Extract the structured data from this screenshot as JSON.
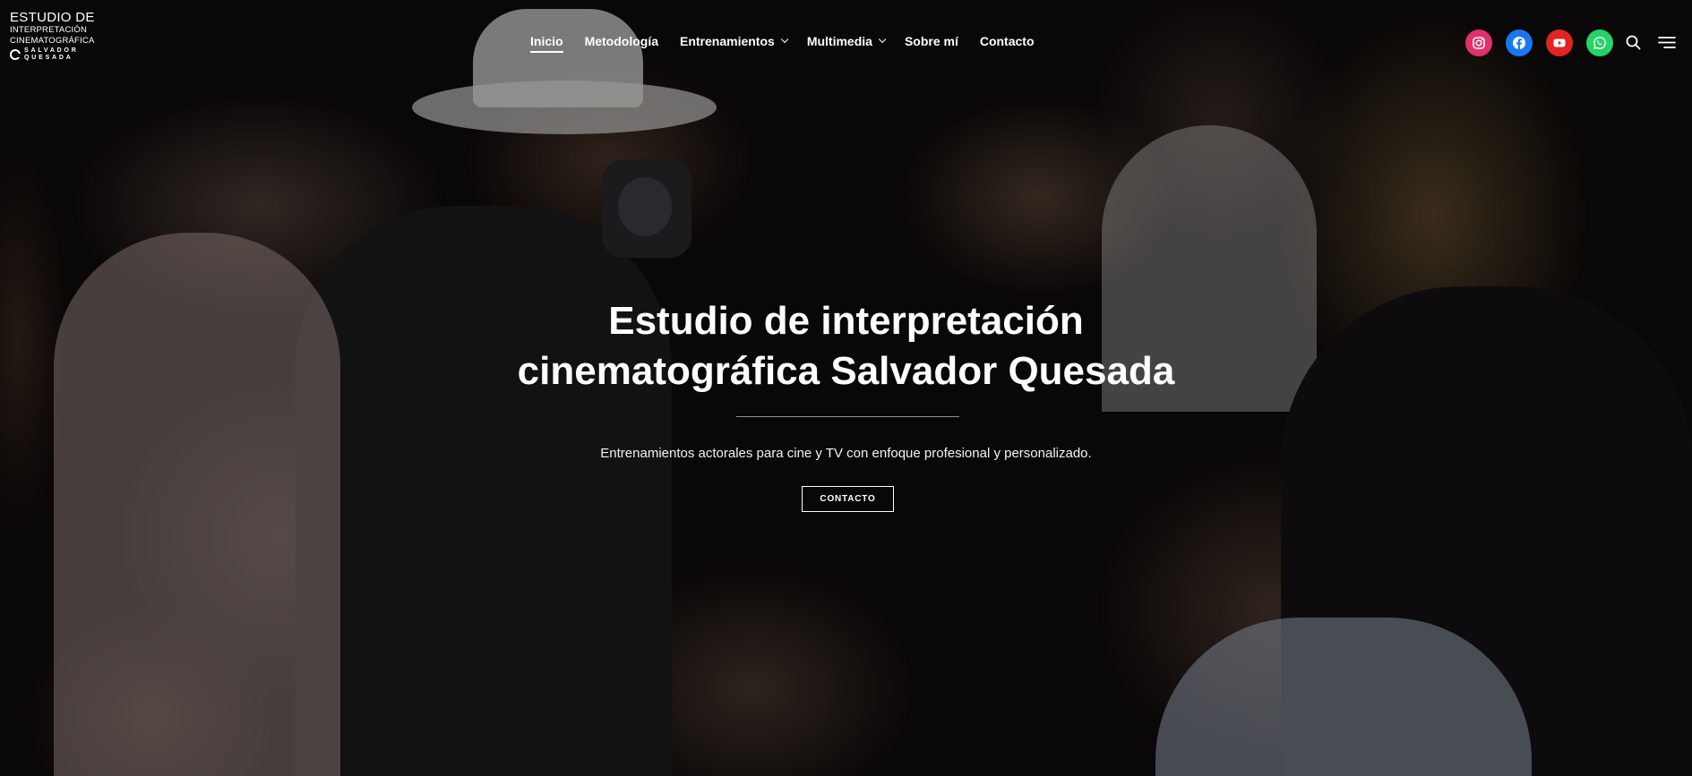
{
  "header": {
    "logo": {
      "line1": "ESTUDIO DE",
      "line2": "INTERPRETACIÓN",
      "line3": "CINEMATOGRÁFICA",
      "line4a": "SALVADOR",
      "line4b": "QUESADA"
    },
    "nav": [
      {
        "label": "Inicio",
        "active": true,
        "dropdown": false
      },
      {
        "label": "Metodología",
        "active": false,
        "dropdown": false
      },
      {
        "label": "Entrenamientos",
        "active": false,
        "dropdown": true
      },
      {
        "label": "Multimedia",
        "active": false,
        "dropdown": true
      },
      {
        "label": "Sobre mí",
        "active": false,
        "dropdown": false
      },
      {
        "label": "Contacto",
        "active": false,
        "dropdown": false
      }
    ],
    "socials": [
      {
        "icon": "instagram-icon",
        "color": "#e1306c"
      },
      {
        "icon": "facebook-icon",
        "color": "#1877f2"
      },
      {
        "icon": "youtube-icon",
        "color": "#e02424"
      },
      {
        "icon": "whatsapp-icon",
        "color": "#25d366"
      }
    ],
    "tools": [
      "search-icon",
      "menu-icon"
    ]
  },
  "hero": {
    "title_line1": "Estudio de interpretación",
    "title_line2": "cinematográfica Salvador Quesada",
    "subtitle": "Entrenamientos actorales para cine y TV con enfoque profesional y personalizado.",
    "cta_label": "CONTACTO"
  }
}
